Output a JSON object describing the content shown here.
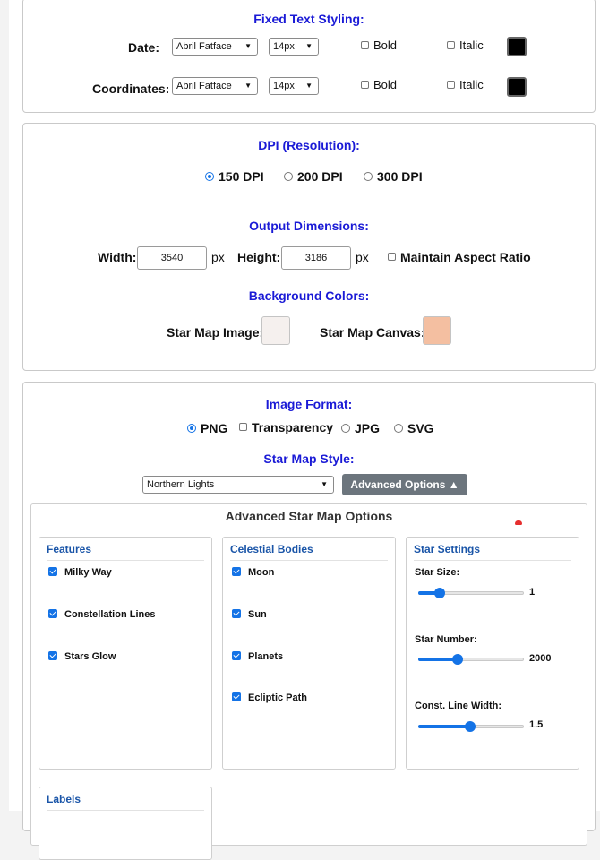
{
  "fixed_text": {
    "heading": "Fixed Text Styling:",
    "rows": [
      {
        "label": "Date:",
        "font": "Abril Fatface",
        "size": "14px",
        "bold": "Bold",
        "italic": "Italic",
        "color": "#000000"
      },
      {
        "label": "Coordinates:",
        "font": "Abril Fatface",
        "size": "14px",
        "bold": "Bold",
        "italic": "Italic",
        "color": "#000000"
      }
    ]
  },
  "dpi": {
    "heading": "DPI (Resolution):",
    "options": [
      "150 DPI",
      "200 DPI",
      "300 DPI"
    ],
    "selected": "150 DPI"
  },
  "output": {
    "heading": "Output Dimensions:",
    "width_label": "Width:",
    "width_value": "3540",
    "height_label": "Height:",
    "height_value": "3186",
    "unit": "px",
    "aspect_label": "Maintain Aspect Ratio"
  },
  "background": {
    "heading": "Background Colors:",
    "image_label": "Star Map Image:",
    "image_color": "#f5f0ee",
    "canvas_label": "Star Map Canvas:",
    "canvas_color": "#f4bfa1"
  },
  "format": {
    "heading": "Image Format:",
    "png": "PNG",
    "transparency": "Transparency",
    "jpg": "JPG",
    "svg": "SVG",
    "selected": "PNG"
  },
  "style": {
    "heading": "Star Map Style:",
    "selected": "Northern Lights",
    "advanced_button": "Advanced Options ▲"
  },
  "advanced": {
    "title": "Advanced Star Map Options",
    "features": {
      "heading": "Features",
      "items": [
        "Milky Way",
        "Constellation Lines",
        "Stars Glow"
      ]
    },
    "celestial": {
      "heading": "Celestial Bodies",
      "items": [
        "Moon",
        "Sun",
        "Planets",
        "Ecliptic Path"
      ]
    },
    "star_settings": {
      "heading": "Star Settings",
      "size_label": "Star Size:",
      "size_value": "1",
      "size_fraction": 0.2,
      "number_label": "Star Number:",
      "number_value": "2000",
      "number_fraction": 0.37,
      "line_label": "Const. Line Width:",
      "line_value": "1.5",
      "line_fraction": 0.49
    },
    "labels": {
      "heading": "Labels"
    }
  },
  "colors": {
    "accent": "#1473e6",
    "heading_blue": "#1a1ad6",
    "subhead_blue": "#1a55a8",
    "button_gray": "#6c757d"
  }
}
